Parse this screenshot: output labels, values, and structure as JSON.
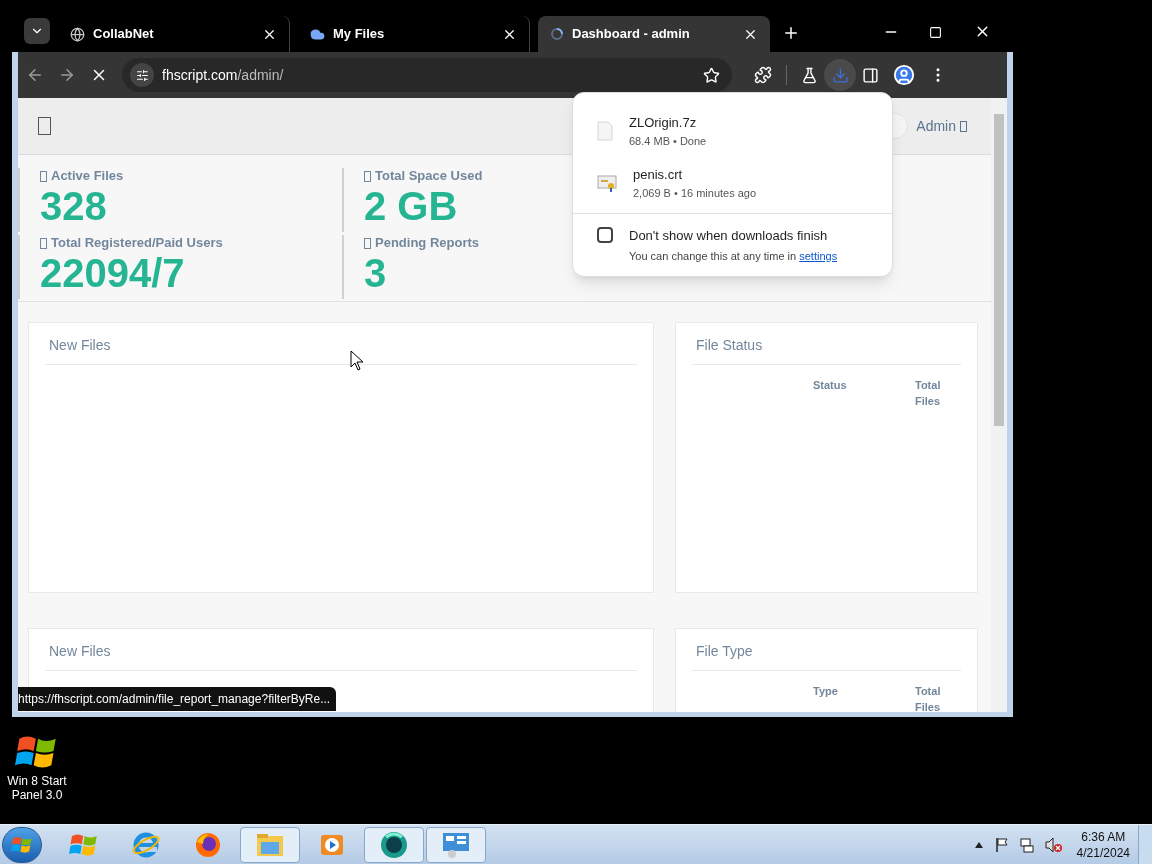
{
  "desktop": {
    "icons": [
      {
        "label": "Win 8 Start Panel 3.0"
      }
    ]
  },
  "browser": {
    "tabs": [
      {
        "title": "CollabNet",
        "kind": "globe",
        "selected": false
      },
      {
        "title": "My Files",
        "kind": "cloud",
        "selected": false
      },
      {
        "title": "Dashboard - admin",
        "kind": "loading",
        "selected": true
      }
    ],
    "address": {
      "host": "fhscript.com",
      "path": "/admin/"
    },
    "loading": true,
    "status_url": "https://fhscript.com/admin/file_report_manage?filterByRe..."
  },
  "header": {
    "user": "Admin"
  },
  "stat_rows": [
    {
      "cells": [
        {
          "label": "Active Files",
          "value": "328"
        },
        {
          "label": "Total Space Used",
          "value": "2 GB"
        }
      ]
    },
    {
      "cells": [
        {
          "label": "Total Registered/Paid Users",
          "value": "22094/7"
        },
        {
          "label": "Pending Reports",
          "value": "3"
        }
      ]
    }
  ],
  "panels": [
    {
      "title": "New Files"
    },
    {
      "title": "File Status",
      "columns": [
        "Status",
        "Total Files"
      ]
    },
    {
      "title": "New Files"
    },
    {
      "title": "File Type",
      "columns": [
        "Type",
        "Total Files"
      ]
    }
  ],
  "downloads_popup": {
    "items": [
      {
        "name": "ZLOrigin.7z",
        "detail": "68.4 MB • Done",
        "kind": "file"
      },
      {
        "name": "penis.crt",
        "detail": "2,069 B • 16 minutes ago",
        "kind": "certificate"
      }
    ],
    "dont_show": {
      "label": "Don't show when downloads finish",
      "checked": false
    },
    "note": "You can change this at any time in",
    "link": "settings"
  },
  "taskbar": {
    "apps": [
      {
        "kind": "windows",
        "open": false
      },
      {
        "kind": "ie",
        "open": false
      },
      {
        "kind": "firefox",
        "open": false
      },
      {
        "kind": "explorer",
        "open": true
      },
      {
        "kind": "media",
        "open": false
      },
      {
        "kind": "chrome",
        "open": true
      },
      {
        "kind": "panel",
        "open": true
      }
    ],
    "time": "6:36 AM",
    "date": "4/21/2024"
  }
}
